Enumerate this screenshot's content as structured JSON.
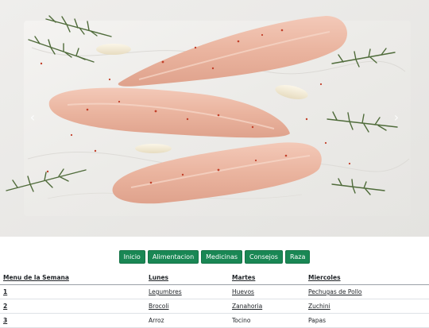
{
  "carousel": {
    "image": "raw-chicken-breasts-on-marble-board",
    "prev_icon": "chevron-left-icon",
    "next_icon": "chevron-right-icon",
    "prev_glyph": "‹",
    "next_glyph": "›"
  },
  "nav": {
    "buttons": [
      "Inicio",
      "Alimentacion",
      "Medicinas",
      "Consejos",
      "Raza"
    ],
    "color": "#198754"
  },
  "table": {
    "headers": [
      "Menu de la Semana",
      "Lunes",
      "Martes",
      "Miercoles"
    ],
    "rows": [
      [
        "1",
        "Legumbres",
        "Huevos",
        "Pechugas de Pollo"
      ],
      [
        "2",
        "Brocoli",
        "Zanahoria",
        "Zuchini"
      ],
      [
        "3",
        "Arroz",
        "Tocino",
        "Papas"
      ]
    ]
  }
}
